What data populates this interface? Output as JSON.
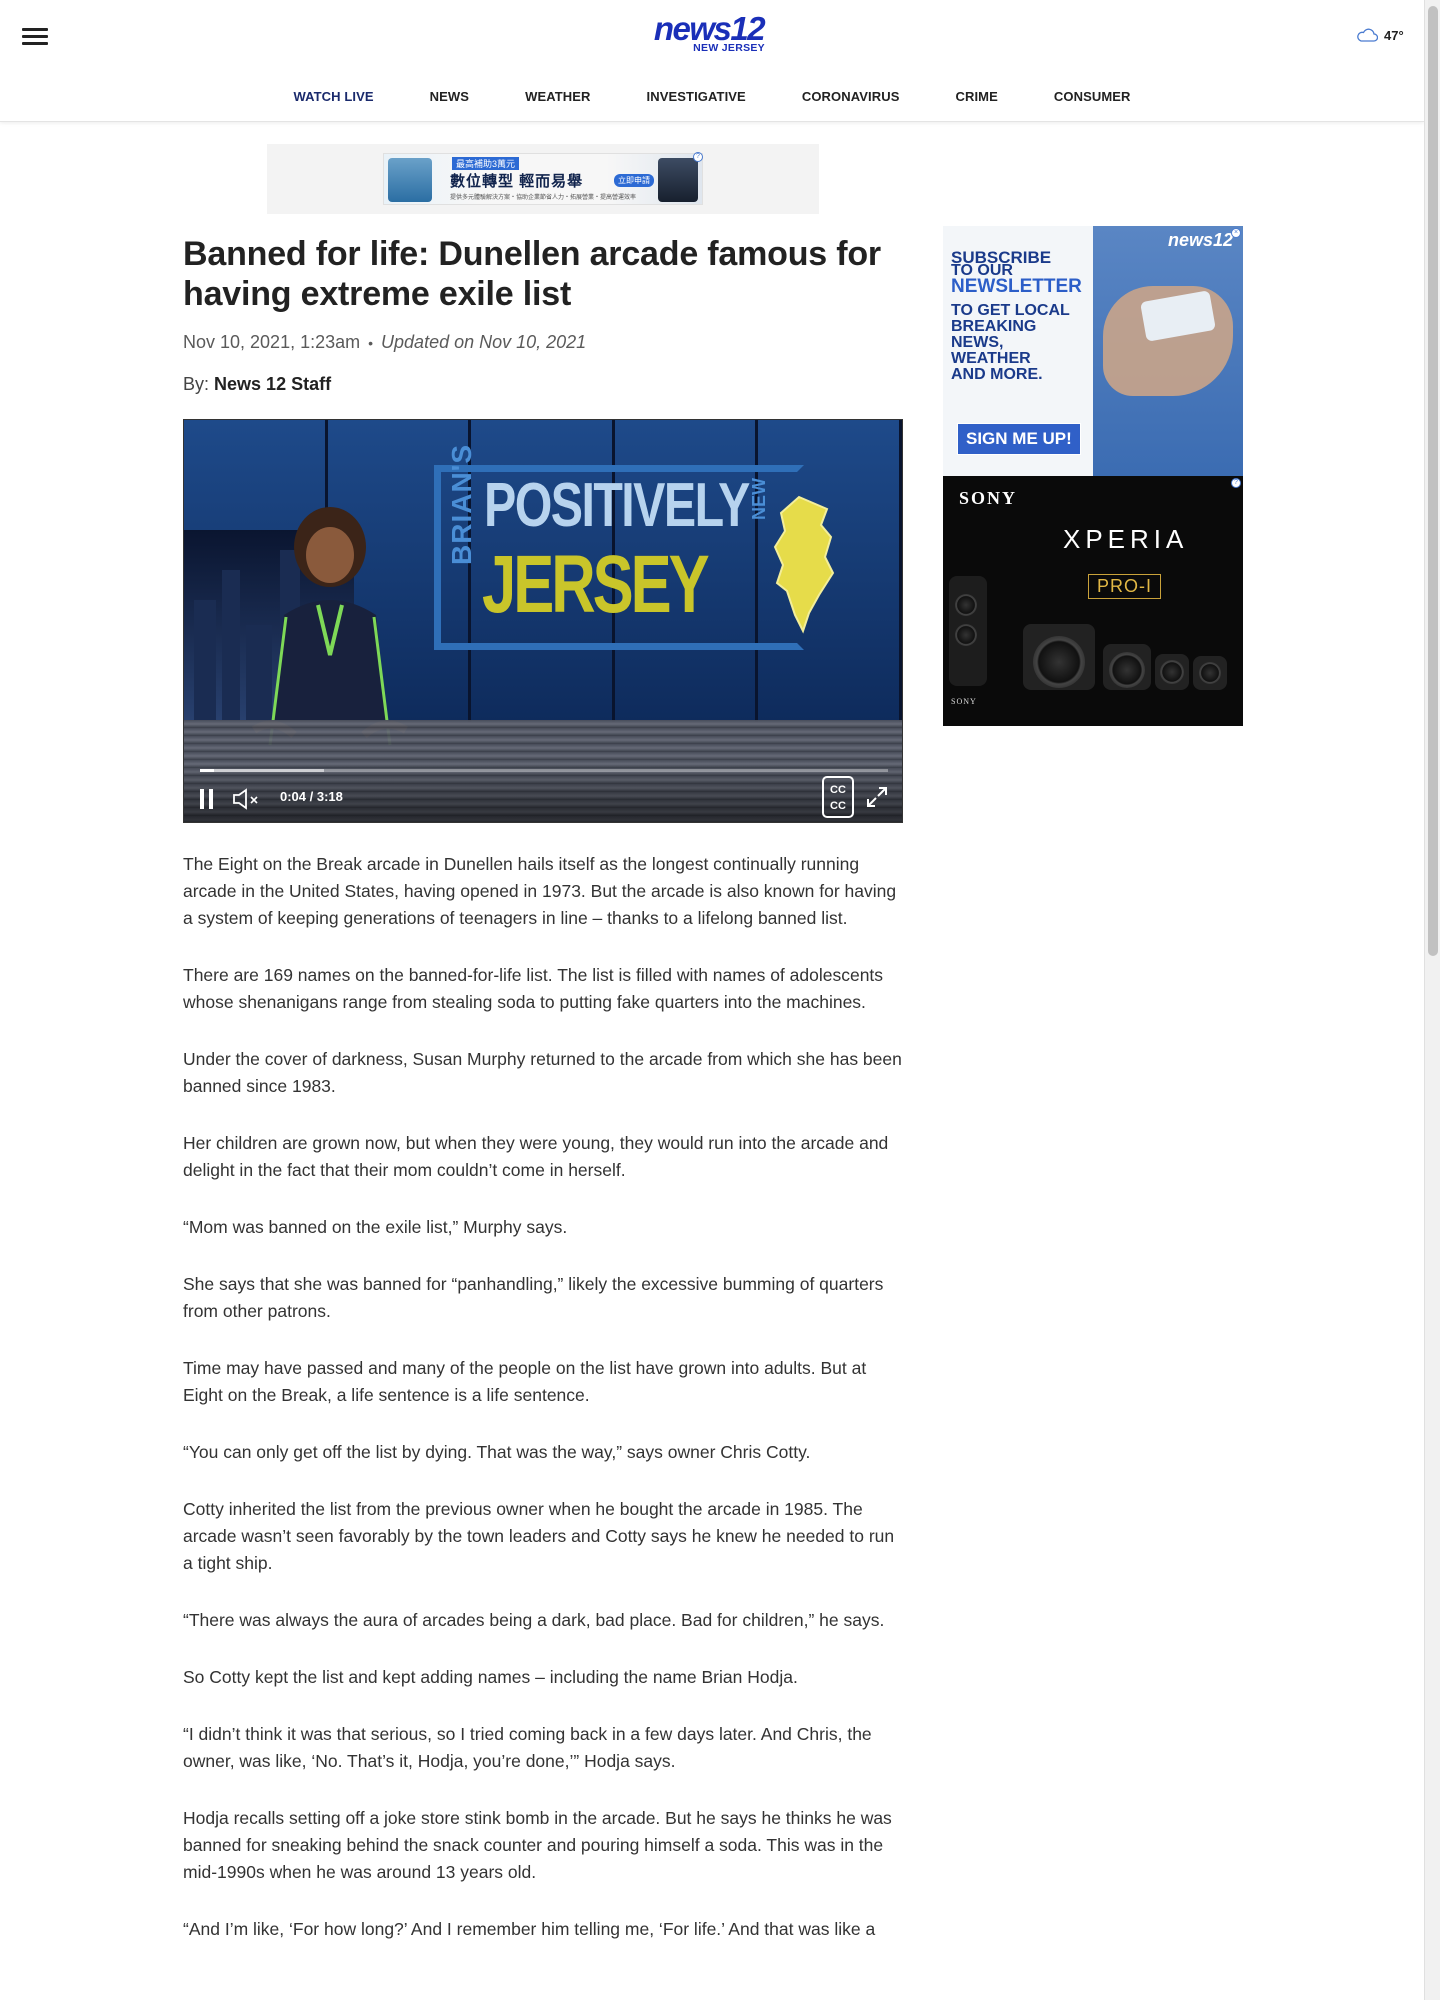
{
  "header": {
    "logo_main": "news12",
    "logo_sub": "NEW JERSEY",
    "weather_temp": "47°",
    "weather_icon": "cloud-icon"
  },
  "nav": [
    {
      "label": "WATCH LIVE"
    },
    {
      "label": "NEWS"
    },
    {
      "label": "WEATHER"
    },
    {
      "label": "INVESTIGATIVE"
    },
    {
      "label": "CORONAVIRUS"
    },
    {
      "label": "CRIME"
    },
    {
      "label": "CONSUMER"
    }
  ],
  "top_ad": {
    "tag": "最高補助3萬元",
    "title": "數位轉型 輕而易舉",
    "button": "立即申請",
    "footnote": "提供多元體驗解決方案・協助企業節省人力・拓展營業・提高營運效率"
  },
  "article": {
    "headline": "Banned for life: Dunellen arcade famous for having extreme exile list",
    "date": "Nov 10, 2021, 1:23am",
    "updated": "Updated on Nov 10, 2021",
    "by_label": "By:",
    "author": "News 12 Staff",
    "paragraphs": [
      "The Eight on the Break arcade in Dunellen hails itself as the longest continually running arcade in the United States, having opened in 1973. But the arcade is also known for having a system of keeping generations of teenagers in line – thanks to a lifelong banned list.",
      "There are 169 names on the banned-for-life list. The list is filled with names of adolescents whose shenanigans range from stealing soda to putting fake quarters into the machines.",
      "Under the cover of darkness, Susan Murphy returned to the arcade from which she has been banned since 1983.",
      "Her children are grown now, but when they were young, they would run into the arcade and delight in the fact that their mom couldn’t come in herself.",
      "“Mom was banned on the exile list,” Murphy says.",
      "She says that she was banned for “panhandling,” likely the excessive bumming of quarters from other patrons.",
      "Time may have passed and many of the people on the list have grown into adults. But at Eight on the Break, a life sentence is a life sentence.",
      "“You can only get off the list by dying. That was the way,” says owner Chris Cotty.",
      "Cotty inherited the list from the previous owner when he bought the arcade in 1985. The arcade wasn’t seen favorably by the town leaders and Cotty says he knew he needed to run a tight ship.",
      "“There was always the aura of arcades being a dark, bad place. Bad for children,” he says.",
      "So Cotty kept the list and kept adding names – including the name Brian Hodja.",
      "“I didn’t think it was that serious, so I tried coming back in a few days later. And Chris, the owner, was like, ‘No. That’s it, Hodja, you’re done,’” Hodja says.",
      "Hodja recalls setting off a joke store stink bomb in the arcade. But he says he thinks he was banned for sneaking behind the snack counter and pouring himself a soda. This was in the mid-1990s when he was around 13 years old.",
      "“And I’m like, ‘For how long?’ And I remember him telling me, ‘For life.’ And that was like a"
    ]
  },
  "video": {
    "brand_line1": "BRIAN'S",
    "brand_line2": "POSITIVELY",
    "brand_line3": "JERSEY",
    "brand_new": "NEW",
    "time": "0:04 / 3:18",
    "played_fraction": 0.0209,
    "loaded_fraction": 0.18
  },
  "rail_ad1": {
    "brand": "news12",
    "line1": "SUBSCRIBE",
    "line2": "TO OUR",
    "line3": "NEWSLETTER",
    "line4": "TO GET LOCAL",
    "line5": "BREAKING",
    "line6": "NEWS,",
    "line7": "WEATHER",
    "line8": "AND MORE.",
    "button": "SIGN ME UP!"
  },
  "rail_ad2": {
    "brand": "SONY",
    "product": "XPERIA",
    "badge": "PRO-I",
    "footer_brand": "SONY"
  }
}
